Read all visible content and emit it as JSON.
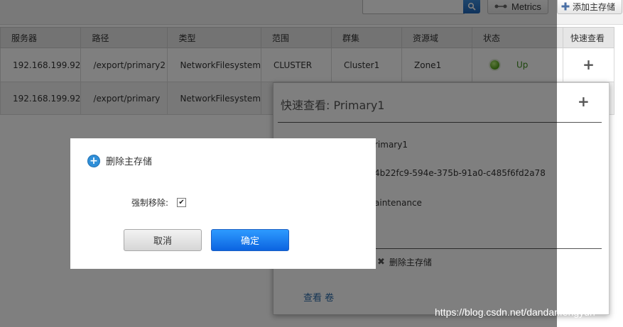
{
  "toolbar": {
    "search_value": "",
    "metrics_label": "Metrics",
    "add_label": "添加主存储"
  },
  "table": {
    "headers": [
      "服务器",
      "路径",
      "类型",
      "范围",
      "群集",
      "资源域",
      "状态",
      "快速查看"
    ],
    "rows": [
      {
        "server": "192.168.199.92",
        "path": "/export/primary2",
        "type": "NetworkFilesystem",
        "scope": "CLUSTER",
        "cluster": "Cluster1",
        "zone": "Zone1",
        "status": "Up"
      },
      {
        "server": "192.168.199.92",
        "path": "/export/primary",
        "type": "NetworkFilesystem",
        "scope": "Z"
      }
    ]
  },
  "quickview": {
    "title": "快速查看: Primary1",
    "name_fragment": "rimary1",
    "id_fragment": "4b22fc9-594e-375b-91a0-c485f6fd2a78",
    "state_fragment": "aintenance",
    "delete_action": "删除主存储",
    "view_link": "查看 卷"
  },
  "dialog": {
    "title": "删除主存储",
    "force_label": "强制移除:",
    "force_checked": true,
    "cancel_label": "取消",
    "ok_label": "确定"
  },
  "watermark": "https://blog.csdn.net/dandanfengyun",
  "colors": {
    "primary_button": "#1677ff",
    "status_up": "#3a8a1a",
    "link": "#2a6aa8"
  }
}
